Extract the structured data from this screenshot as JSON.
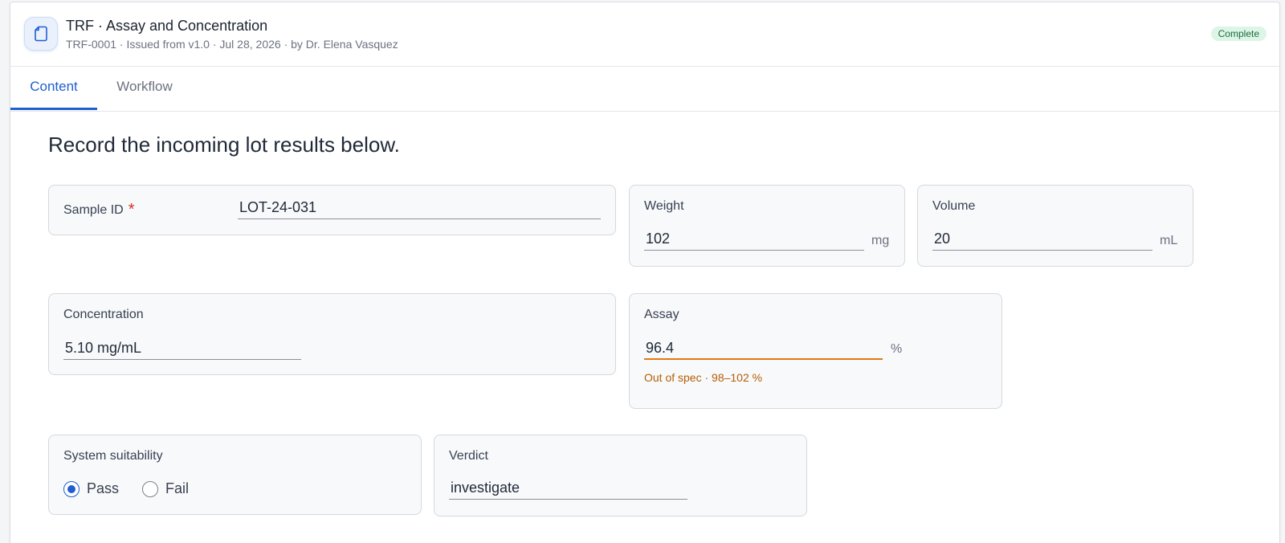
{
  "header": {
    "title": "TRF · Assay and Concentration",
    "subtitle": "TRF-0001 · Issued from v1.0 · Jul 28, 2026 · by Dr. Elena Vasquez",
    "status": "Complete",
    "icon": "document-icon"
  },
  "tabs": [
    {
      "label": "Content",
      "active": true
    },
    {
      "label": "Workflow",
      "active": false
    }
  ],
  "instructions": "Record the incoming lot results below.",
  "fields": {
    "sample_id": {
      "label": "Sample ID",
      "required": "*",
      "value": "LOT-24-031"
    },
    "weight": {
      "label": "Weight",
      "value": "102",
      "unit": "mg"
    },
    "volume": {
      "label": "Volume",
      "value": "20",
      "unit": "mL"
    },
    "concentration": {
      "label": "Concentration",
      "value": "5.10 mg/mL"
    },
    "assay": {
      "label": "Assay",
      "value": "96.4",
      "unit": "%",
      "warning": "Out of spec · 98–102 %"
    },
    "system_suitability": {
      "label": "System suitability",
      "options": [
        "Pass",
        "Fail"
      ],
      "selected": "Pass"
    },
    "verdict": {
      "label": "Verdict",
      "value": "investigate"
    }
  },
  "colors": {
    "accent": "#1f5fd1",
    "warning": "#e07a10",
    "required": "#d93025",
    "success_bg": "#dcf5e6"
  }
}
